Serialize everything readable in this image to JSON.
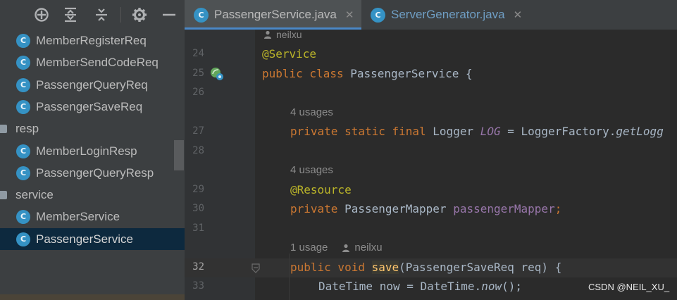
{
  "sidebar": {
    "toolbar": [
      {
        "name": "locate-icon"
      },
      {
        "name": "expand-all-icon"
      },
      {
        "name": "collapse-all-icon"
      },
      {
        "name": "gear-icon"
      },
      {
        "name": "minimize-icon"
      }
    ],
    "items": [
      {
        "kind": "class",
        "label": "MemberRegisterReq"
      },
      {
        "kind": "class",
        "label": "MemberSendCodeReq"
      },
      {
        "kind": "class",
        "label": "PassengerQueryReq"
      },
      {
        "kind": "class",
        "label": "PassengerSaveReq"
      },
      {
        "kind": "folder",
        "label": "resp"
      },
      {
        "kind": "class",
        "label": "MemberLoginResp"
      },
      {
        "kind": "class",
        "label": "PassengerQueryResp"
      },
      {
        "kind": "folder",
        "label": "service"
      },
      {
        "kind": "class",
        "label": "MemberService"
      },
      {
        "kind": "class",
        "label": "PassengerService",
        "selected": true
      }
    ]
  },
  "tabs": [
    {
      "label": "PassengerService.java",
      "active": true
    },
    {
      "label": "ServerGenerator.java",
      "active": false
    }
  ],
  "editor": {
    "author_hint": "neilxu",
    "line_numbers": [
      "24",
      "25",
      "26",
      "27",
      "28",
      "29",
      "30",
      "31",
      "32",
      "33"
    ],
    "current_line": "32",
    "usages_4a": "4 usages",
    "usages_4b": "4 usages",
    "usages_1": "1 usage",
    "usage_author": "neilxu",
    "l24_annotation": "@Service",
    "l25_kw": "public class",
    "l25_name": " PassengerService {",
    "l27_kw": "private static final",
    "l27_type": " Logger ",
    "l27_field": "LOG",
    "l27_rest": " = LoggerFactory.",
    "l27_call": "getLogg",
    "l29_annotation": "@Resource",
    "l30_kw": "private",
    "l30_type": " PassengerMapper ",
    "l30_field": "passengerMapper",
    "l30_end": ";",
    "l32_kw": "public void",
    "l32_sp": " ",
    "l32_fn": "save",
    "l32_rest": "(PassengerSaveReq req) {",
    "l33_left": "DateTime now = DateTime.",
    "l33_call": "now",
    "l33_end": "();"
  },
  "watermark": "CSDN @NEIL_XU_",
  "colors": {
    "class_icon": "#3592c4",
    "keyword": "#cc7832",
    "annotation": "#bbb529",
    "field": "#9876aa",
    "method": "#ffc66d"
  }
}
